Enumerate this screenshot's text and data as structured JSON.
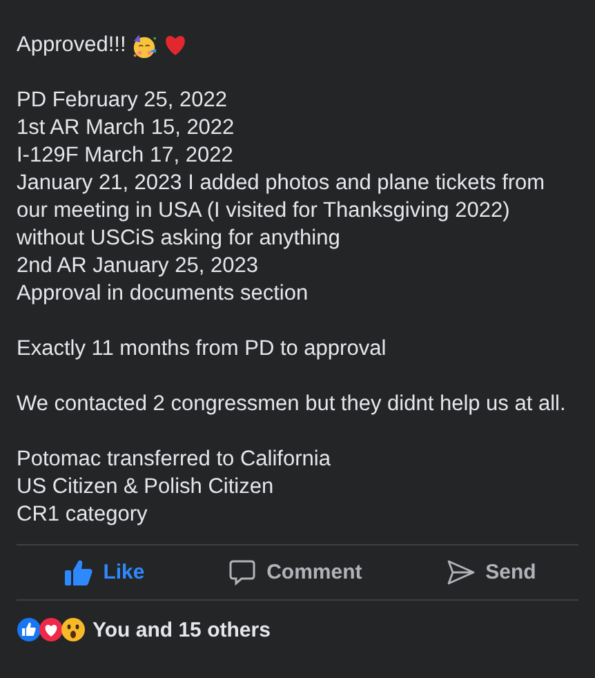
{
  "post": {
    "headline": "Approved!!!",
    "paragraphs": [
      [
        "PD February 25, 2022",
        "1st AR March 15, 2022",
        "I-129F March 17, 2022",
        "January 21, 2023 I added photos and plane tickets from our meeting in USA (I visited for Thanksgiving 2022) without USCiS asking for anything",
        "2nd AR January 25, 2023",
        "Approval in documents section"
      ],
      [
        "Exactly 11 months from PD to approval"
      ],
      [
        "We contacted 2 congressmen but they didnt help us at all."
      ],
      [
        "Potomac transferred to California",
        "US Citizen & Polish Citizen",
        "CR1 category"
      ]
    ]
  },
  "actions": [
    {
      "kind": "like",
      "label": "Like",
      "selected": true
    },
    {
      "kind": "comment",
      "label": "Comment",
      "selected": false
    },
    {
      "kind": "send",
      "label": "Send",
      "selected": false
    }
  ],
  "reactions": {
    "icons": [
      {
        "kind": "like"
      },
      {
        "kind": "love"
      },
      {
        "kind": "wow"
      }
    ],
    "summary": "You and 15 others"
  }
}
